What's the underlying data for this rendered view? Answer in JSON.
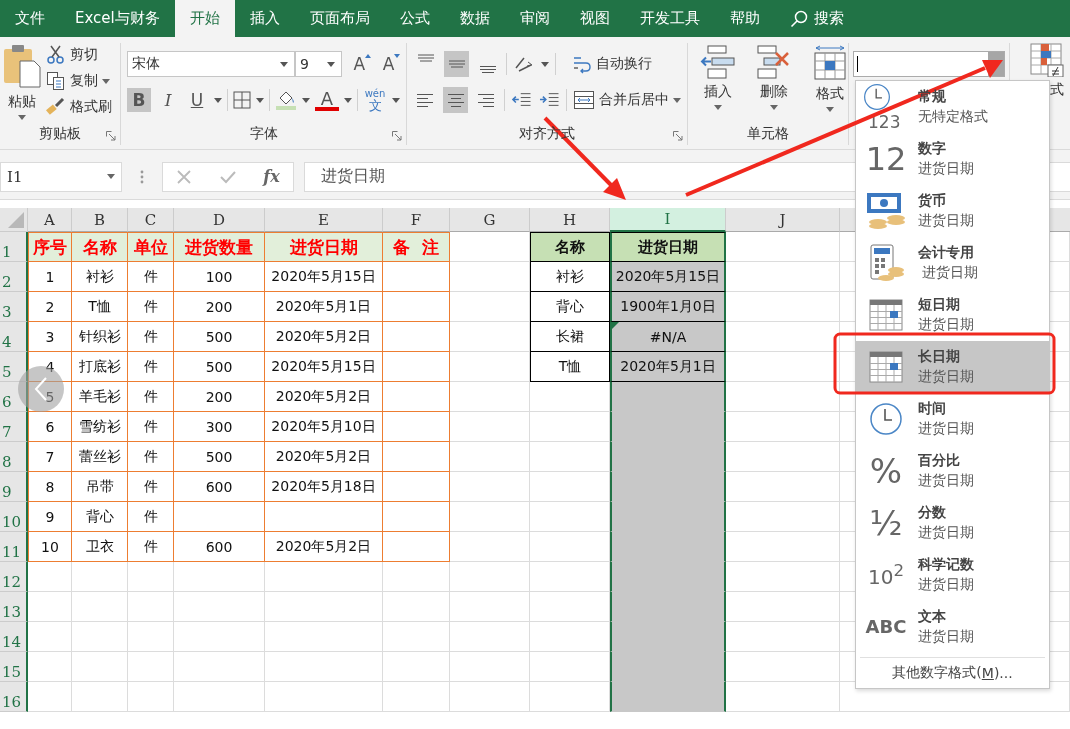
{
  "tabs": [
    {
      "label": "文件",
      "selected": false
    },
    {
      "label": "Excel与财务",
      "selected": false
    },
    {
      "label": "开始",
      "selected": true
    },
    {
      "label": "插入",
      "selected": false
    },
    {
      "label": "页面布局",
      "selected": false
    },
    {
      "label": "公式",
      "selected": false
    },
    {
      "label": "数据",
      "selected": false
    },
    {
      "label": "审阅",
      "selected": false
    },
    {
      "label": "视图",
      "selected": false
    },
    {
      "label": "开发工具",
      "selected": false
    },
    {
      "label": "帮助",
      "selected": false
    }
  ],
  "search": {
    "label": "搜索"
  },
  "clipboard": {
    "paste": "粘贴",
    "cut": "剪切",
    "copy": "复制",
    "format_painter": "格式刷",
    "group": "剪贴板"
  },
  "font": {
    "name": "宋体",
    "size": "9",
    "group": "字体",
    "size_buttons": [
      {
        "kind": "grow",
        "glyph": "A"
      },
      {
        "kind": "shrink",
        "glyph": "A"
      }
    ],
    "style_buttons": [
      {
        "kind": "bold",
        "glyph": "B",
        "on": true
      },
      {
        "kind": "italic",
        "glyph": "I",
        "on": false
      },
      {
        "kind": "underline",
        "glyph": "U",
        "on": false
      }
    ],
    "color_glyph": "A",
    "phonetic_top": "wén",
    "phonetic_bottom": "文"
  },
  "alignment": {
    "vertical": [
      {
        "kind": "top",
        "selected": false
      },
      {
        "kind": "middle",
        "selected": true
      },
      {
        "kind": "bottom",
        "selected": false
      }
    ],
    "horizontal": [
      {
        "kind": "left",
        "selected": false
      },
      {
        "kind": "center",
        "selected": true
      },
      {
        "kind": "right",
        "selected": false
      }
    ],
    "wrap_text": "自动换行",
    "merge_center": "合并后居中",
    "group": "对齐方式"
  },
  "cells": {
    "insert": "插入",
    "delete": "删除",
    "format": "格式",
    "group": "单元格"
  },
  "conditional_format": {
    "label": "式"
  },
  "formula_bar": {
    "name_box": "I1",
    "fx": "fx",
    "formula": "进货日期"
  },
  "sheet": {
    "columns": [
      {
        "letter": "A",
        "selected": false
      },
      {
        "letter": "B",
        "selected": false
      },
      {
        "letter": "C",
        "selected": false
      },
      {
        "letter": "D",
        "selected": false
      },
      {
        "letter": "E",
        "selected": false
      },
      {
        "letter": "F",
        "selected": false
      },
      {
        "letter": "G",
        "selected": false
      },
      {
        "letter": "H",
        "selected": false
      },
      {
        "letter": "I",
        "selected": true
      },
      {
        "letter": "J",
        "selected": false
      }
    ],
    "rows": [
      "1",
      "2",
      "3",
      "4",
      "5",
      "6",
      "7",
      "8",
      "9",
      "10",
      "11",
      "12",
      "13",
      "14",
      "15",
      "16"
    ],
    "sales_table": {
      "headers": [
        "序号",
        "名称",
        "单位",
        "进货数量",
        "进货日期",
        "备  注"
      ],
      "rows": [
        {
          "no": "1",
          "name": "衬衫",
          "unit": "件",
          "qty": "100",
          "date": "2020年5月15日"
        },
        {
          "no": "2",
          "name": "T恤",
          "unit": "件",
          "qty": "200",
          "date": "2020年5月1日"
        },
        {
          "no": "3",
          "name": "针织衫",
          "unit": "件",
          "qty": "500",
          "date": "2020年5月2日"
        },
        {
          "no": "4",
          "name": "打底衫",
          "unit": "件",
          "qty": "500",
          "date": "2020年5月15日"
        },
        {
          "no": "5",
          "name": "羊毛衫",
          "unit": "件",
          "qty": "200",
          "date": "2020年5月2日"
        },
        {
          "no": "6",
          "name": "雪纺衫",
          "unit": "件",
          "qty": "300",
          "date": "2020年5月10日"
        },
        {
          "no": "7",
          "name": "蕾丝衫",
          "unit": "件",
          "qty": "500",
          "date": "2020年5月2日"
        },
        {
          "no": "8",
          "name": "吊带",
          "unit": "件",
          "qty": "600",
          "date": "2020年5月18日"
        },
        {
          "no": "9",
          "name": "背心",
          "unit": "件"
        },
        {
          "no": "10",
          "name": "卫衣",
          "unit": "件",
          "qty": "600",
          "date": "2020年5月2日"
        }
      ]
    },
    "lookup_table": {
      "headers": [
        "名称",
        "进货日期"
      ],
      "rows": [
        {
          "name": "衬衫",
          "date": "2020年5月15日",
          "error_flag": false
        },
        {
          "name": "背心",
          "date": "1900年1月0日",
          "error_flag": false
        },
        {
          "name": "长裙",
          "date": "#N/A",
          "error_flag": true
        },
        {
          "name": "T恤",
          "date": "2020年5月1日",
          "error_flag": false
        }
      ]
    }
  },
  "format_menu": {
    "items": [
      {
        "kind": "general",
        "title": "常规",
        "preview": "无特定格式",
        "icon_text": "123",
        "selected": false
      },
      {
        "kind": "number",
        "title": "数字",
        "preview": "进货日期",
        "icon_text": "12",
        "selected": false
      },
      {
        "kind": "currency",
        "title": "货币",
        "preview": "进货日期",
        "selected": false
      },
      {
        "kind": "accounting",
        "title": "会计专用",
        "preview": " 进货日期",
        "selected": false
      },
      {
        "kind": "short_date",
        "title": "短日期",
        "preview": "进货日期",
        "selected": false
      },
      {
        "kind": "long_date",
        "title": "长日期",
        "preview": "进货日期",
        "selected": true
      },
      {
        "kind": "time",
        "title": "时间",
        "preview": "进货日期",
        "selected": false
      },
      {
        "kind": "percent",
        "title": "百分比",
        "preview": "进货日期",
        "icon_text": "%",
        "selected": false
      },
      {
        "kind": "fraction",
        "title": "分数",
        "preview": "进货日期",
        "icon_text": "½",
        "selected": false
      },
      {
        "kind": "scientific",
        "title": "科学记数",
        "preview": "进货日期",
        "icon_text": "10$^{2}$",
        "selected": false
      },
      {
        "kind": "text",
        "title": "文本",
        "preview": "进货日期",
        "icon_text": "ABC",
        "selected": false
      }
    ],
    "footer": {
      "before": "其他数字格式(",
      "key": "M",
      "after": ")..."
    }
  }
}
